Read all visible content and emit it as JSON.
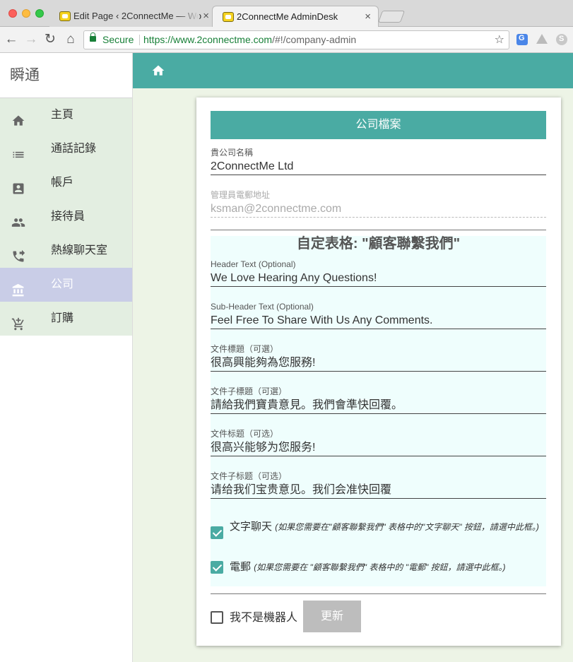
{
  "browser": {
    "tabs": [
      {
        "title": "Edit Page ‹ 2ConnectMe — Wo",
        "active": false
      },
      {
        "title": "2ConnectMe AdminDesk",
        "active": true
      }
    ],
    "close_glyph": "×",
    "secure_label": "Secure",
    "url_host": "https://www.2connectme.com",
    "url_path": "/#!/company-admin",
    "extensions": [
      "google-translate-icon",
      "google-drive-icon",
      "skype-icon"
    ]
  },
  "sidebar": {
    "brand": "瞬通",
    "items": [
      {
        "label": "主頁",
        "icon": "home-icon",
        "active": false
      },
      {
        "label": "通話記錄",
        "icon": "list-icon",
        "active": false
      },
      {
        "label": "帳戶",
        "icon": "account-box-icon",
        "active": false
      },
      {
        "label": "接待員",
        "icon": "people-icon",
        "active": false
      },
      {
        "label": "熱線聊天室",
        "icon": "phone-forward-icon",
        "active": false
      },
      {
        "label": "公司",
        "icon": "bank-icon",
        "active": true
      },
      {
        "label": "訂購",
        "icon": "add-to-cart-icon",
        "active": false
      }
    ]
  },
  "colors": {
    "accent": "#4aaba3",
    "sidebar_bg": "#e3eee1",
    "sidebar_active": "#c9cde7",
    "content_bg": "#edf4e6",
    "custom_block_bg": "#effefd",
    "button_disabled": "#bdbdbd"
  },
  "card": {
    "title": "公司檔案",
    "company_name": {
      "label": "貴公司名稱",
      "value": "2ConnectMe Ltd"
    },
    "admin_email": {
      "label": "管理員電郵地址",
      "value": "ksman@2connectme.com",
      "disabled": true
    },
    "custom_form_title": "自定表格: \"顧客聯繫我們\"",
    "fields": [
      {
        "label": "Header Text (Optional)",
        "value": "We Love Hearing Any Questions!"
      },
      {
        "label": "Sub-Header Text (Optional)",
        "value": "Feel Free To Share With Us Any Comments."
      },
      {
        "label": "文件標題（可選）",
        "value": "很高興能夠為您服務!"
      },
      {
        "label": "文件子標題（可選）",
        "value": "請給我們寶貴意見。我們會準快回覆。"
      },
      {
        "label": "文件标题（可选）",
        "value": "很高兴能够为您服务!"
      },
      {
        "label": "文件子标题（可选）",
        "value": "请给我们宝贵意见。我们会准快回覆"
      }
    ],
    "checkboxes": [
      {
        "label": "文字聊天",
        "note": "(如果您需要在\"顧客聯繫我們\" 表格中的\"文字聊天\" 按鈕，請選中此框。)",
        "checked": true
      },
      {
        "label": "電郵",
        "note": "(如果您需要在 \"顧客聯繫我們\" 表格中的 \"電郵\" 按鈕，請選中此框。)",
        "checked": true
      }
    ],
    "captcha": {
      "label": "我不是機器人",
      "checked": false
    },
    "update_button": "更新"
  }
}
